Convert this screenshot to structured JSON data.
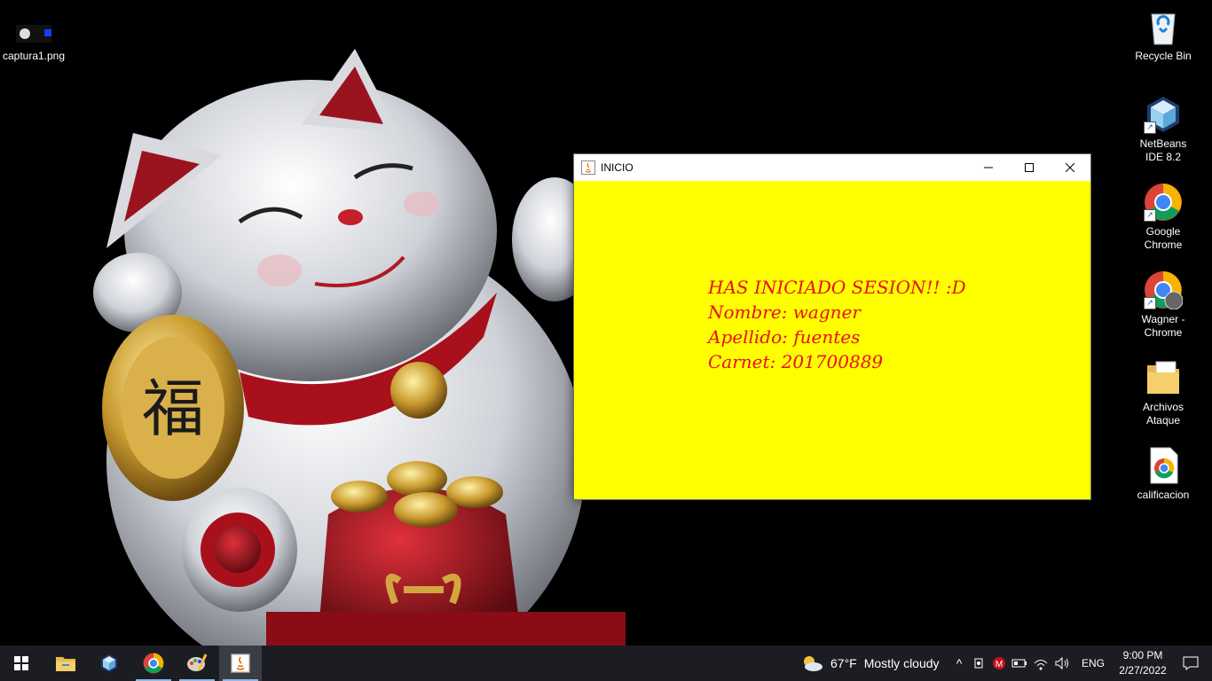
{
  "desktop": {
    "icons_left": [
      {
        "label": "captura1.png",
        "icon": "image-file-icon"
      }
    ],
    "icons_right": [
      {
        "label": "Recycle Bin",
        "icon": "recycle-bin-icon"
      },
      {
        "label": "NetBeans IDE 8.2",
        "icon": "netbeans-icon"
      },
      {
        "label": "Google Chrome",
        "icon": "chrome-icon"
      },
      {
        "label": "Wagner - Chrome",
        "icon": "chrome-profile-icon"
      },
      {
        "label": "Archivos Ataque",
        "icon": "folder-icon"
      },
      {
        "label": "calificacion",
        "icon": "chrome-html-file-icon"
      }
    ]
  },
  "window": {
    "title": "INICIO",
    "background_color": "#ffff00",
    "text_color": "#e8101a",
    "lines": [
      "HAS INICIADO SESION!! :D",
      "Nombre: wagner",
      "Apellido: fuentes",
      "Carnet: 201700889"
    ],
    "controls": {
      "minimize": "—",
      "maximize": "☐",
      "close": "✕"
    }
  },
  "taskbar": {
    "weather_temp": "67°F",
    "weather_text": "Mostly cloudy",
    "language": "ENG",
    "time": "9:00 PM",
    "date": "2/27/2022",
    "pinned": [
      "start-icon",
      "file-explorer-icon",
      "netbeans-icon",
      "chrome-icon",
      "paint-icon",
      "java-icon"
    ]
  }
}
